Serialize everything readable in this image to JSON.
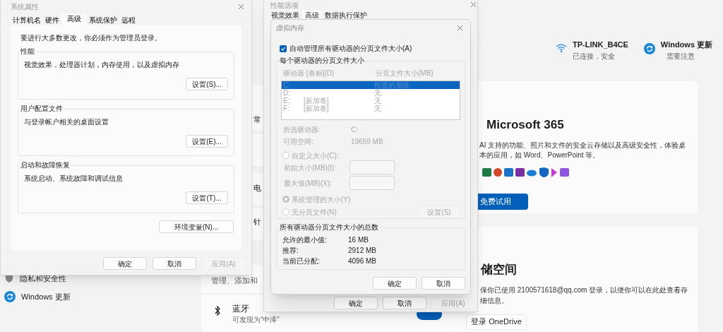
{
  "settings": {
    "sidebar": [
      {
        "label": "隐私和安全性",
        "kind": "shield"
      },
      {
        "label": "Windows 更新",
        "kind": "update"
      }
    ],
    "fragments": [
      "常",
      "电",
      "针"
    ],
    "devices_text": "管理、添加和",
    "bluetooth": {
      "title": "蓝牙",
      "subtitle": "可发现为“中泽”",
      "on": true
    },
    "status": [
      {
        "title": "TP-LINK_B4CE",
        "subtitle": "已连接，安全",
        "kind": "wifi"
      },
      {
        "title": "Windows 更新",
        "subtitle": "需要注意",
        "kind": "update"
      }
    ],
    "m365": {
      "title": "Microsoft 365",
      "lines": [
        "AI 支持的功能、照片和文件的安全云存储以及高级安全性，体验桌",
        "本的应用，如 Word、PowerPoint 等。"
      ],
      "button": "免费试用"
    },
    "storage": {
      "title": "储空间",
      "lines": [
        "保你已使用 2100571618@qq.com 登录，以便你可以在此处查看存",
        "细信息。"
      ],
      "button": "登录 OneDrive"
    }
  },
  "performance_options": {
    "title": "性能选项",
    "tabs": [
      {
        "label": "视觉效果",
        "selected": false
      },
      {
        "label": "高级",
        "selected": true
      },
      {
        "label": "数据执行保护",
        "selected": false
      }
    ],
    "buttons": [
      {
        "label": "确定",
        "disabled": false
      },
      {
        "label": "取消",
        "disabled": false
      },
      {
        "label": "应用(A)",
        "disabled": true
      }
    ]
  },
  "system_properties": {
    "title": "系统属性",
    "tabs": [
      {
        "label": "计算机名",
        "selected": false
      },
      {
        "label": "硬件",
        "selected": false
      },
      {
        "label": "高级",
        "selected": true
      },
      {
        "label": "系统保护",
        "selected": false
      },
      {
        "label": "远程",
        "selected": false
      }
    ],
    "admin_note": "要进行大多数更改，你必须作为管理员登录。",
    "groups": [
      {
        "title": "性能",
        "description": "视觉效果，处理器计划，内存使用，以及虚拟内存",
        "button": "设置(S)..."
      },
      {
        "title": "用户配置文件",
        "description": "与登录帐户相关的桌面设置",
        "button": "设置(E)..."
      },
      {
        "title": "启动和故障恢复",
        "description": "系统启动、系统故障和调试信息",
        "button": "设置(T)..."
      }
    ],
    "env_button": "环境变量(N)...",
    "buttons": [
      {
        "label": "确定",
        "disabled": false
      },
      {
        "label": "取消",
        "disabled": false
      },
      {
        "label": "应用(A)",
        "disabled": true
      }
    ]
  },
  "virtual_memory": {
    "title": "虚拟内存",
    "auto_manage": {
      "label": "自动管理所有驱动器的分页文件大小(A)",
      "checked": true
    },
    "per_drive": {
      "title": "每个驱动器的分页文件大小",
      "columns": [
        "驱动器 [卷标](D)",
        "分页文件大小(MB)"
      ],
      "drives": [
        {
          "drive": "C:",
          "size": "托管的系统",
          "selected": true
        },
        {
          "drive": "D:",
          "size": "无",
          "selected": false
        },
        {
          "drive": "E:",
          "volume": "[新加卷]",
          "size": "无",
          "selected": false
        },
        {
          "drive": "F:",
          "volume": "[新加卷]",
          "size": "无",
          "selected": false
        }
      ],
      "info": [
        {
          "label": "所选驱动器:",
          "value": "C:"
        },
        {
          "label": "可用空间:",
          "value": "19659 MB"
        }
      ],
      "options": [
        {
          "label": "自定义大小(C):",
          "selected": false
        },
        {
          "label": "系统管理的大小(Y)",
          "selected": true
        },
        {
          "label": "无分页文件(N)",
          "selected": false
        }
      ],
      "size_fields": [
        {
          "label": "初始大小(MB)(I):"
        },
        {
          "label": "最大值(MB)(X):"
        }
      ],
      "set_button": "设置(S)"
    },
    "totals": {
      "title": "所有驱动器分页文件大小的总数",
      "rows": [
        {
          "label": "允许的最小值:",
          "value": "16 MB"
        },
        {
          "label": "推荐:",
          "value": "2912 MB"
        },
        {
          "label": "当前已分配:",
          "value": "4096 MB"
        }
      ]
    },
    "buttons": [
      {
        "label": "确定",
        "disabled": false
      },
      {
        "label": "取消",
        "disabled": false
      }
    ]
  }
}
